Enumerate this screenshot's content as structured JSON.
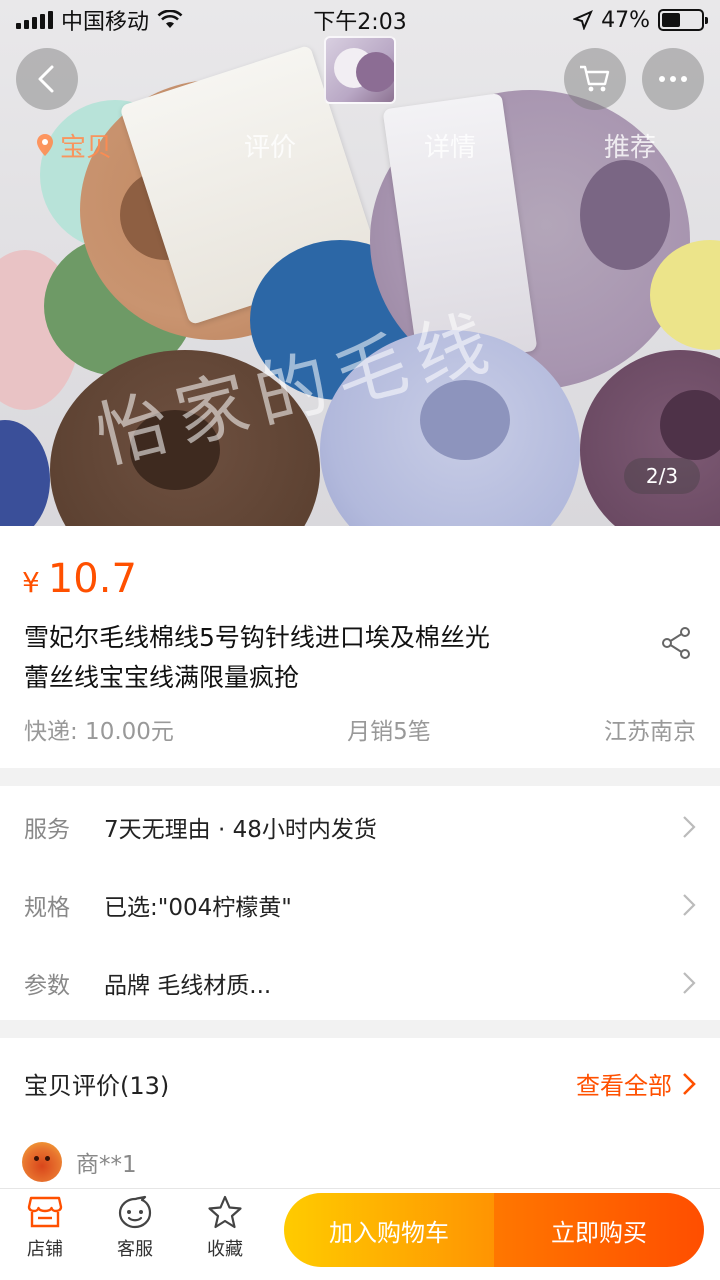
{
  "status_bar": {
    "carrier": "中国移动",
    "time": "下午2:03",
    "battery": "47%",
    "battery_level": 0.47,
    "icons": [
      "signal-icon",
      "wifi-icon",
      "location-arrow-icon",
      "battery-icon"
    ]
  },
  "hero": {
    "watermark": "怡家的毛线",
    "pager": "2/3",
    "nav_icons": [
      "back-icon",
      "cart-icon",
      "more-icon"
    ]
  },
  "nav_tabs": [
    {
      "label": "宝贝",
      "active": true
    },
    {
      "label": "评价",
      "active": false
    },
    {
      "label": "详情",
      "active": false
    },
    {
      "label": "推荐",
      "active": false
    }
  ],
  "product": {
    "currency": "¥",
    "price": "10.7",
    "title_line1": "雪妃尔毛线棉线5号钩针线进口埃及棉丝光",
    "title_line2": "蕾丝线宝宝线满限量疯抢",
    "shipping": "快递: 10.00元",
    "monthly_sales": "月销5笔",
    "location": "江苏南京"
  },
  "service": {
    "rows": [
      {
        "label": "服务",
        "value": "7天无理由 · 48小时内发货"
      },
      {
        "label": "规格",
        "value": "已选:\"004柠檬黄\""
      },
      {
        "label": "参数",
        "value": "品牌 毛线材质..."
      }
    ]
  },
  "reviews": {
    "title": "宝贝评价(13)",
    "view_all": "查看全部",
    "first_user": "商**1"
  },
  "bottom_bar": {
    "shop": "店铺",
    "service": "客服",
    "favorite": "收藏",
    "add_to_cart": "加入购物车",
    "buy_now": "立即购买"
  },
  "colors": {
    "accent": "#ff5000",
    "cart_button": "#ffa000",
    "buy_button": "#ff5a00"
  }
}
